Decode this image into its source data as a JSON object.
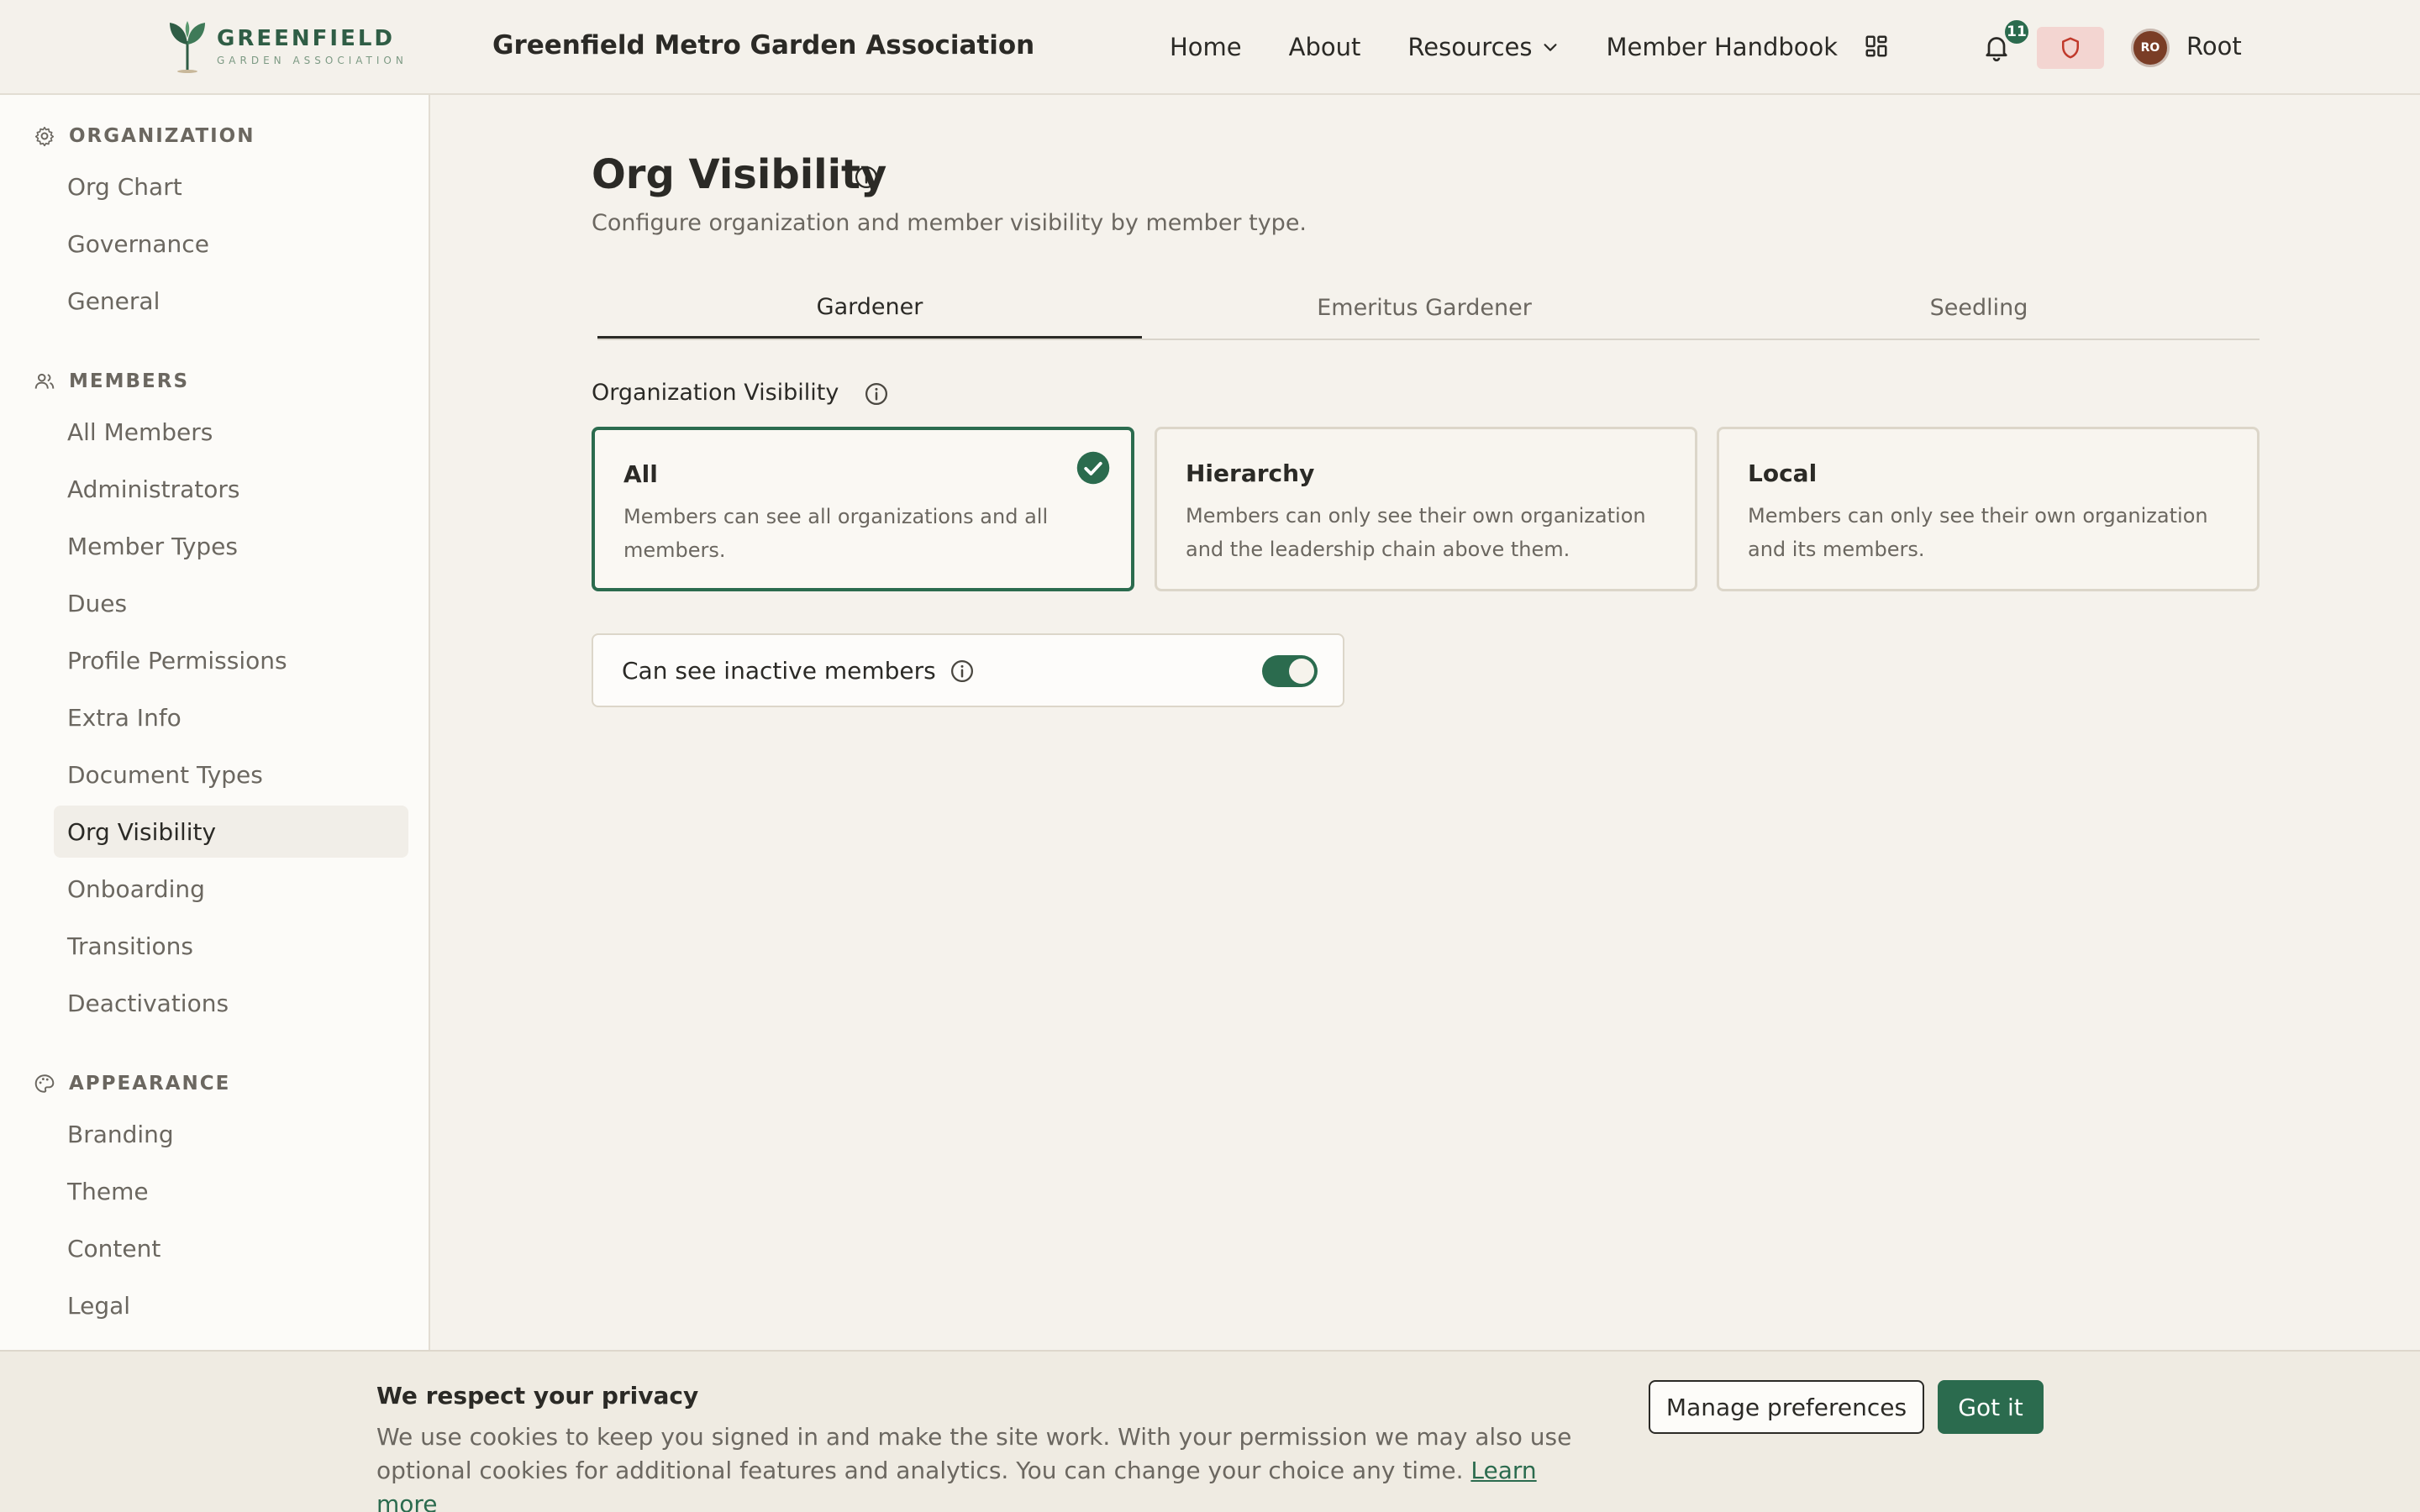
{
  "header": {
    "logo_main": "GREENFIELD",
    "logo_sub": "GARDEN ASSOCIATION",
    "site_title": "Greenfield Metro Garden Association",
    "nav": [
      "Home",
      "About",
      "Resources",
      "Member Handbook"
    ],
    "notification_count": "11",
    "avatar_initials": "RO",
    "user_name": "Root",
    "accent_color": "#2b6b4e"
  },
  "sidebar": {
    "groups": [
      {
        "title": "ORGANIZATION",
        "icon": "gear-icon",
        "items": [
          "Org Chart",
          "Governance",
          "General"
        ]
      },
      {
        "title": "MEMBERS",
        "icon": "users-icon",
        "items": [
          "All Members",
          "Administrators",
          "Member Types",
          "Dues",
          "Profile Permissions",
          "Extra Info",
          "Document Types",
          "Org Visibility",
          "Onboarding",
          "Transitions",
          "Deactivations"
        ]
      },
      {
        "title": "APPEARANCE",
        "icon": "palette-icon",
        "items": [
          "Branding",
          "Theme",
          "Content",
          "Legal"
        ]
      }
    ],
    "active_item": "Org Visibility"
  },
  "main": {
    "title": "Org Visibility",
    "subtitle": "Configure organization and member visibility by member type.",
    "tabs": [
      "Gardener",
      "Emeritus Gardener",
      "Seedling"
    ],
    "active_tab": "Gardener",
    "section_label": "Organization Visibility",
    "options": [
      {
        "title": "All",
        "desc": "Members can see all organizations and all members.",
        "selected": true
      },
      {
        "title": "Hierarchy",
        "desc": "Members can only see their own organization and the leadership chain above them.",
        "selected": false
      },
      {
        "title": "Local",
        "desc": "Members can only see their own organization and its members.",
        "selected": false
      }
    ],
    "toggle_label": "Can see inactive members",
    "toggle_on": true
  },
  "cookie": {
    "title": "We respect your privacy",
    "text": "We use cookies to keep you signed in and make the site work. With your permission we may also use optional cookies for additional features and analytics. You can change your choice any time.",
    "link": "Learn more",
    "manage_label": "Manage preferences",
    "accept_label": "Got it"
  }
}
